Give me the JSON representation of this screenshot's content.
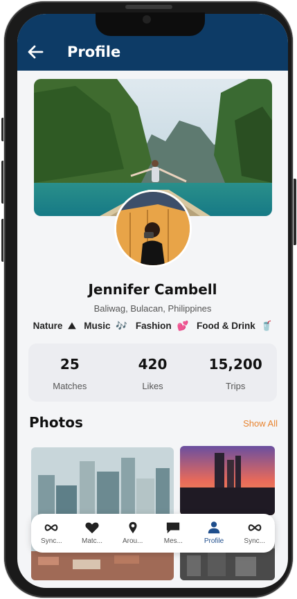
{
  "app": {
    "header_title": "Profile",
    "accent_color": "#0d3b66",
    "highlight_color": "#e8832e"
  },
  "profile": {
    "name": "Jennifer Cambell",
    "location": "Baliwag, Bulacan, Philippines",
    "interests": [
      {
        "label": "Nature",
        "emoji": "⛰"
      },
      {
        "label": "Music",
        "emoji": "🎶"
      },
      {
        "label": "Fashion",
        "emoji": "💕"
      },
      {
        "label": "Food & Drink",
        "emoji": "🥤"
      }
    ]
  },
  "stats": [
    {
      "value": "25",
      "label": "Matches"
    },
    {
      "value": "420",
      "label": "Likes"
    },
    {
      "value": "15,200",
      "label": "Trips"
    }
  ],
  "photos": {
    "title": "Photos",
    "show_all_label": "Show All"
  },
  "nav": {
    "items": [
      {
        "label": "Sync...",
        "icon": "infinity-icon"
      },
      {
        "label": "Matc...",
        "icon": "heart-icon"
      },
      {
        "label": "Arou...",
        "icon": "location-pin-icon"
      },
      {
        "label": "Mes...",
        "icon": "message-icon"
      },
      {
        "label": "Profile",
        "icon": "person-icon",
        "active": true
      },
      {
        "label": "Sync...",
        "icon": "infinity-icon"
      }
    ]
  }
}
